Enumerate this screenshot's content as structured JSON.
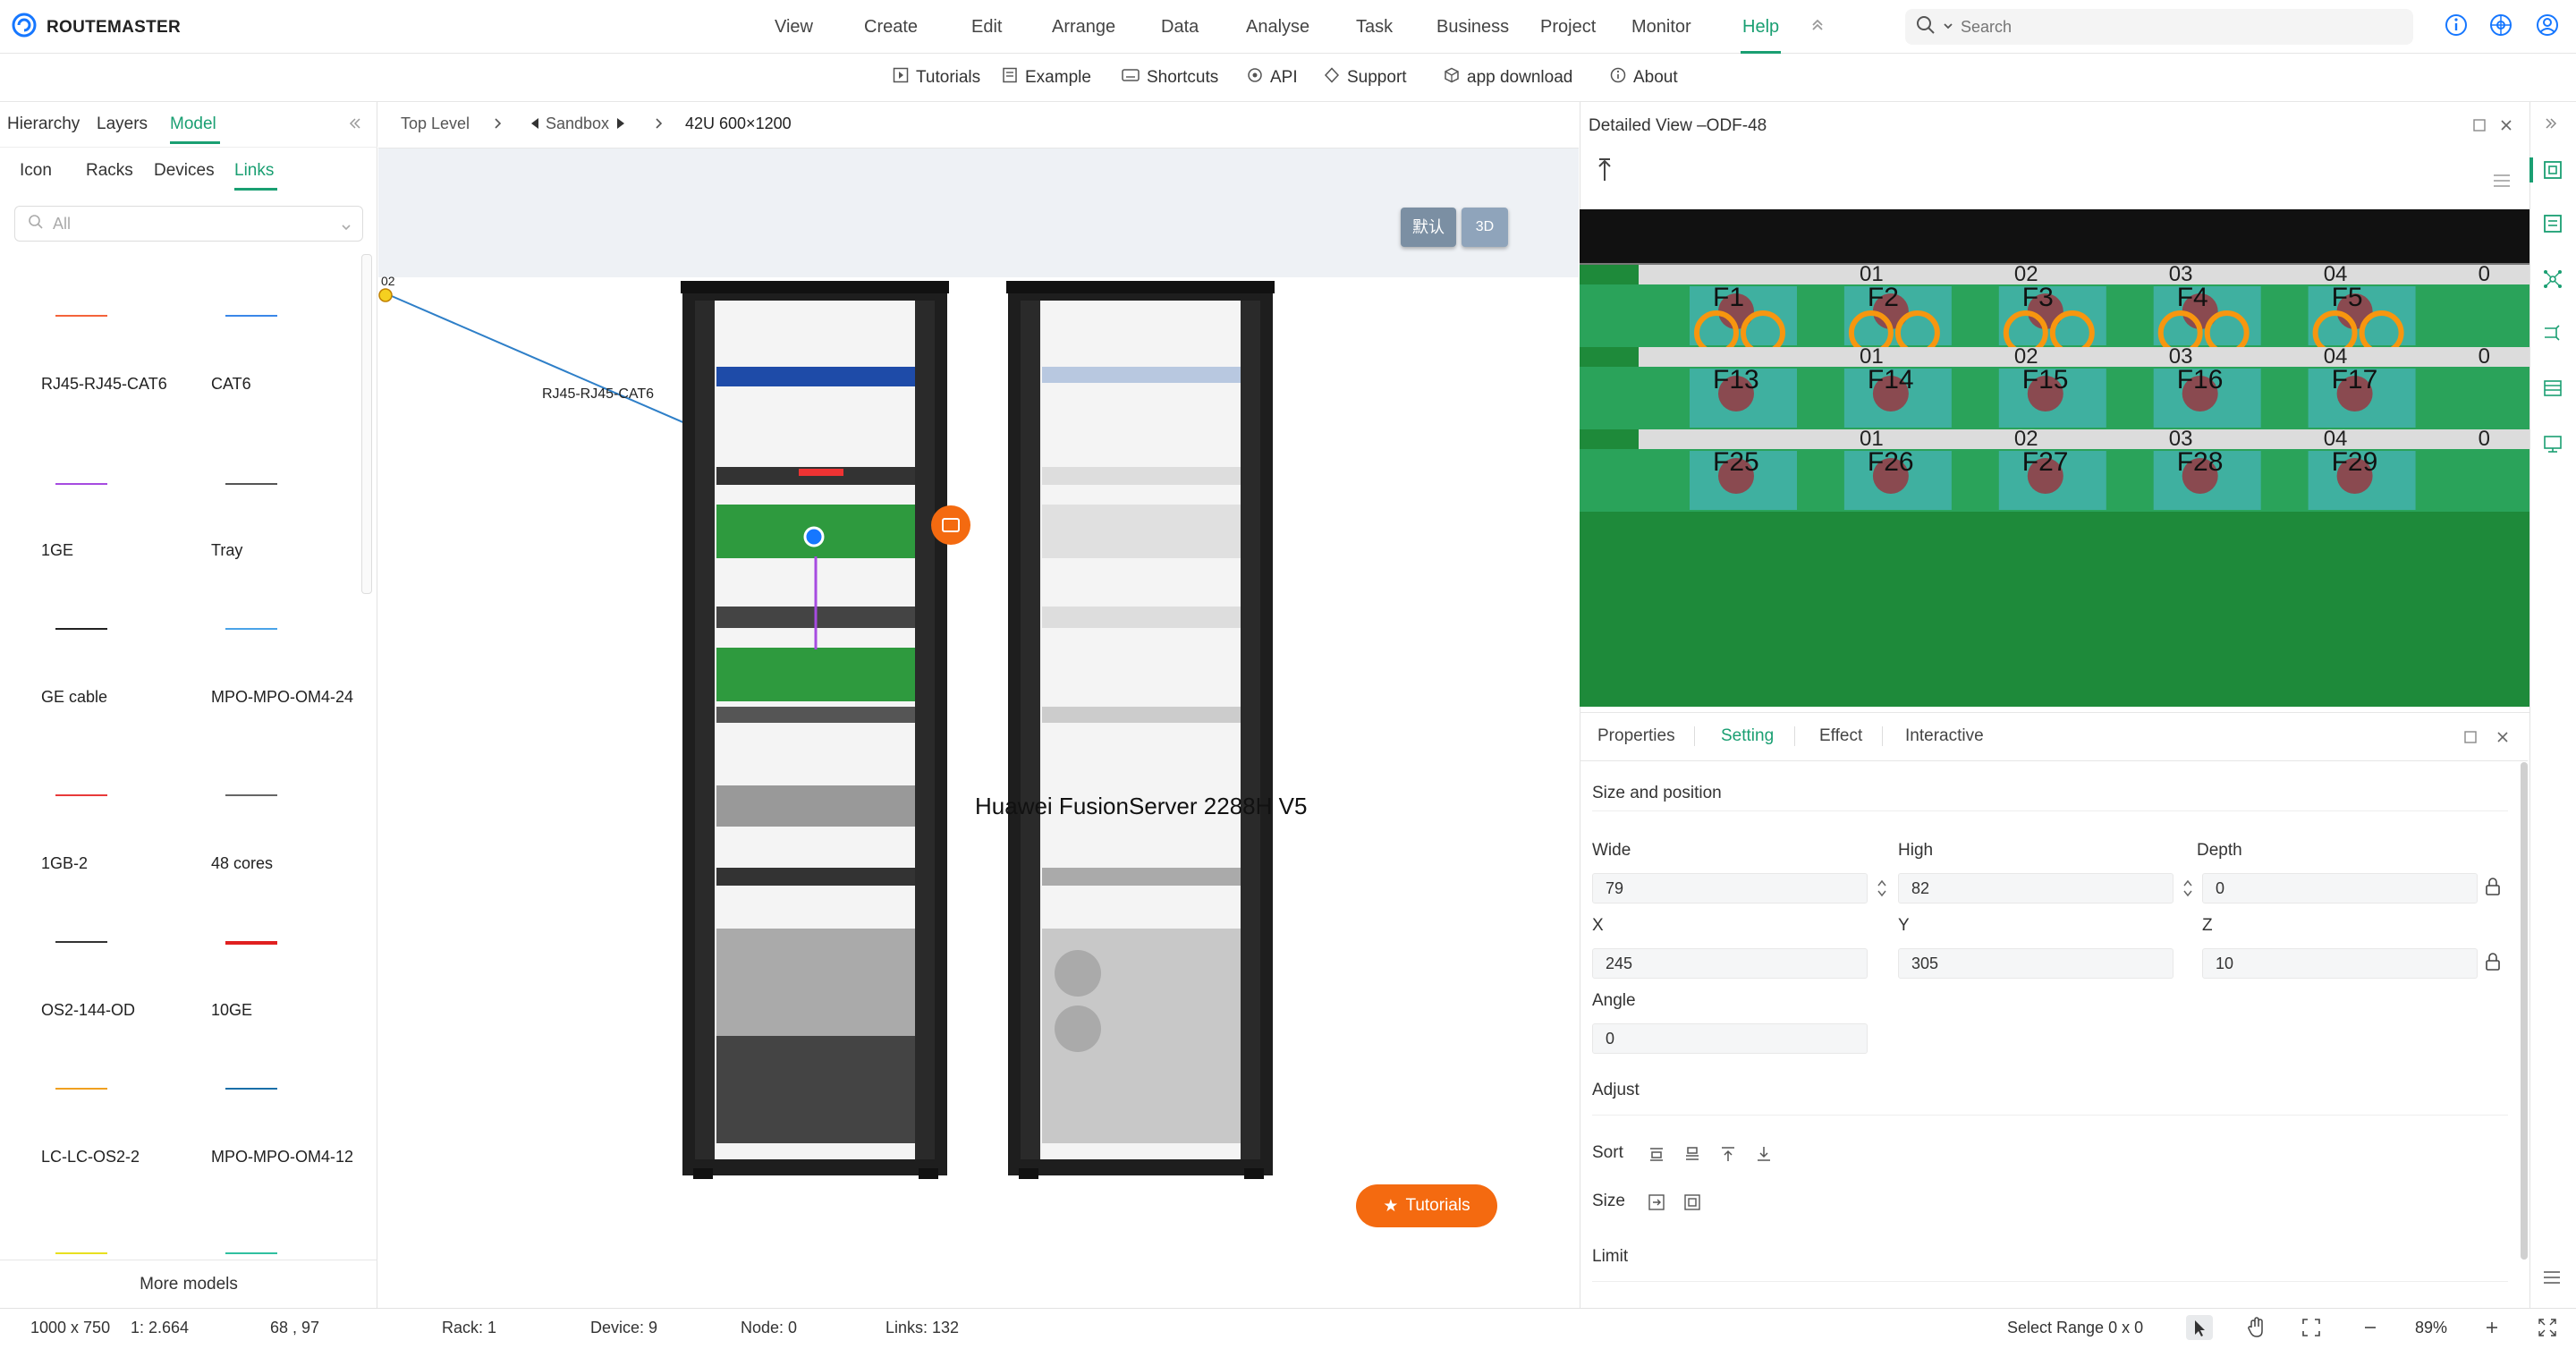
{
  "app": {
    "title": "ROUTEMASTER",
    "brand_color": "#1a9f72",
    "accent_color": "#1677ff"
  },
  "menu": {
    "items": [
      {
        "label": "View"
      },
      {
        "label": "Create"
      },
      {
        "label": "Edit"
      },
      {
        "label": "Arrange"
      },
      {
        "label": "Data"
      },
      {
        "label": "Analyse"
      },
      {
        "label": "Task"
      },
      {
        "label": "Business"
      },
      {
        "label": "Project"
      },
      {
        "label": "Monitor"
      },
      {
        "label": "Help",
        "active": true
      }
    ],
    "collapse_icon": "double-chevron-up-icon"
  },
  "search": {
    "placeholder": "Search"
  },
  "submenu": {
    "items": [
      {
        "label": "Tutorials",
        "icon": "play-icon"
      },
      {
        "label": "Example",
        "icon": "document-icon"
      },
      {
        "label": "Shortcuts",
        "icon": "keyboard-icon"
      },
      {
        "label": "API",
        "icon": "api-icon"
      },
      {
        "label": "Support",
        "icon": "support-icon"
      },
      {
        "label": "app download",
        "icon": "package-icon"
      },
      {
        "label": "About",
        "icon": "info-icon"
      }
    ]
  },
  "left_panel": {
    "tabs": [
      {
        "label": "Hierarchy"
      },
      {
        "label": "Layers"
      },
      {
        "label": "Model",
        "active": true
      }
    ],
    "subtabs": [
      {
        "label": "Icon"
      },
      {
        "label": "Racks"
      },
      {
        "label": "Devices"
      },
      {
        "label": "Links",
        "active": true
      }
    ],
    "filter_value": "All",
    "links": [
      {
        "label": "RJ45-RJ45-CAT6",
        "color": "#f4633a"
      },
      {
        "label": "CAT6",
        "color": "#3a87e8"
      },
      {
        "label": "1GE",
        "color": "#a64be0"
      },
      {
        "label": "Tray",
        "color": "#555555"
      },
      {
        "label": "GE cable",
        "color": "#222222"
      },
      {
        "label": "MPO-MPO-OM4-24",
        "color": "#4aa3e8"
      },
      {
        "label": "1GB-2",
        "color": "#e83a3a"
      },
      {
        "label": "48 cores",
        "color": "#666666"
      },
      {
        "label": "OS2-144-OD",
        "color": "#333333"
      },
      {
        "label": "10GE",
        "color": "#e02020"
      },
      {
        "label": "LC-LC-OS2-2",
        "color": "#f0a020"
      },
      {
        "label": "MPO-MPO-OM4-12",
        "color": "#1a6fa8"
      }
    ],
    "more_label": "More models"
  },
  "canvas": {
    "breadcrumb": {
      "top": "Top Level",
      "middle": "Sandbox",
      "current": "42U 600×1200"
    },
    "view_buttons": {
      "default": "默认",
      "three_d": "3D"
    },
    "port_label": "02",
    "link_label": "RJ45-RJ45-CAT6",
    "device_label": "Huawei FusionServer 2288H V5",
    "tutorials_button": "Tutorials"
  },
  "detail": {
    "title": "Detailed View –ODF-48",
    "port_numbers": [
      "01",
      "02",
      "03",
      "04",
      "0"
    ],
    "port_rows": [
      [
        "F1",
        "F2",
        "F3",
        "F4",
        "F5"
      ],
      [
        "F13",
        "F14",
        "F15",
        "F16",
        "F17"
      ],
      [
        "F25",
        "F26",
        "F27",
        "F28",
        "F29"
      ]
    ]
  },
  "props": {
    "tabs": [
      {
        "label": "Properties"
      },
      {
        "label": "Setting",
        "active": true
      },
      {
        "label": "Effect"
      },
      {
        "label": "Interactive"
      }
    ],
    "section_size": "Size and position",
    "wide_label": "Wide",
    "wide": "79",
    "high_label": "High",
    "high": "82",
    "depth_label": "Depth",
    "depth": "0",
    "x_label": "X",
    "x": "245",
    "y_label": "Y",
    "y": "305",
    "z_label": "Z",
    "z": "10",
    "angle_label": "Angle",
    "angle": "0",
    "adjust_label": "Adjust",
    "sort_label": "Sort",
    "size_label": "Size",
    "limit_label": "Limit"
  },
  "status": {
    "canvas_size": "1000 x 750",
    "scale": "1: 2.664",
    "coords": "68 , 97",
    "rack": "Rack: 1",
    "device": "Device: 9",
    "node": "Node: 0",
    "links": "Links: 132",
    "select_range": "Select Range  0 x 0",
    "zoom": "89%"
  }
}
